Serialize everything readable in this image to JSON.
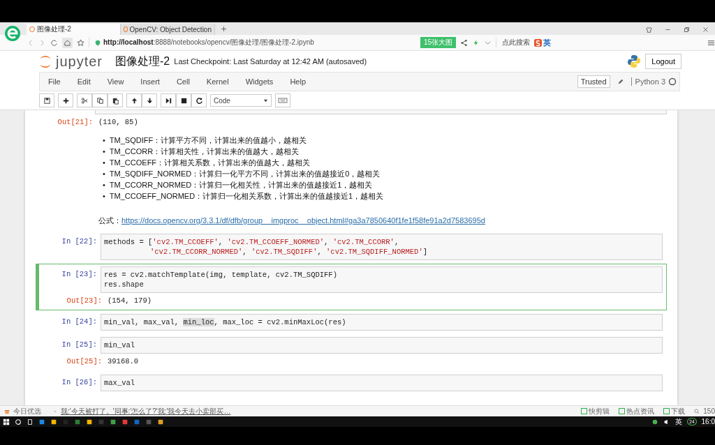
{
  "browser": {
    "tabs": [
      {
        "label": "图像处理-2",
        "selected": true
      },
      {
        "label": "OpenCV: Object Detection",
        "selected": false
      }
    ],
    "url_host": "http://localhost",
    "url_rest": ":8888/notebooks/opencv/图像处理/图像处理-2.ipynb",
    "badge": "15张大图",
    "search_hint": "点此搜索",
    "ime": "英"
  },
  "jupyter": {
    "logo": "jupyter",
    "title": "图像处理-2",
    "checkpoint": "Last Checkpoint: Last Saturday at 12:42 AM (autosaved)",
    "logout": "Logout",
    "menu": [
      "File",
      "Edit",
      "View",
      "Insert",
      "Cell",
      "Kernel",
      "Widgets",
      "Help"
    ],
    "trusted": "Trusted",
    "kernel": "Python 3",
    "cell_type": "Code"
  },
  "cells": [
    {
      "kind": "output",
      "prompt": "Out[21]:",
      "text": "(110, 85)"
    },
    {
      "kind": "markdown",
      "bullet": "•",
      "items": [
        "TM_SQDIFF：计算平方不同，计算出来的值越小，越相关",
        "TM_CCORR：计算相关性，计算出来的值越大，越相关",
        "TM_CCOEFF：计算相关系数，计算出来的值越大，越相关",
        "TM_SQDIFF_NORMED：计算归一化平方不同，计算出来的值越接近0，越相关",
        "TM_CCORR_NORMED：计算归一化相关性，计算出来的值越接近1，越相关",
        "TM_CCOEFF_NORMED：计算归一化相关系数，计算出来的值越接近1，越相关"
      ],
      "label": "公式：",
      "link": "https://docs.opencv.org/3.3.1/df/dfb/group__imgproc__object.html#ga3a7850640f1fe1f58fe91a2d7583695d"
    },
    {
      "kind": "code",
      "prompt": "In [22]:",
      "selected": false,
      "lines": [
        {
          "indent": false,
          "tokens": [
            {
              "t": "methods = [",
              "kind": "plain"
            },
            {
              "t": "'cv2.TM_CCOEFF'",
              "kind": "string"
            },
            {
              "t": ", ",
              "kind": "plain"
            },
            {
              "t": "'cv2.TM_CCOEFF_NORMED'",
              "kind": "string"
            },
            {
              "t": ", ",
              "kind": "plain"
            },
            {
              "t": "'cv2.TM_CCORR'",
              "kind": "string"
            },
            {
              "t": ",",
              "kind": "plain"
            }
          ]
        },
        {
          "indent": true,
          "tokens": [
            {
              "t": "'cv2.TM_CCORR_NORMED'",
              "kind": "string"
            },
            {
              "t": ", ",
              "kind": "plain"
            },
            {
              "t": "'cv2.TM_SQDIFF'",
              "kind": "string"
            },
            {
              "t": ", ",
              "kind": "plain"
            },
            {
              "t": "'cv2.TM_SQDIFF_NORMED'",
              "kind": "string"
            },
            {
              "t": "]",
              "kind": "plain"
            }
          ]
        }
      ]
    },
    {
      "kind": "code",
      "prompt": "In [23]:",
      "selected": true,
      "lines": [
        {
          "indent": false,
          "tokens": [
            {
              "t": "res = cv2.matchTemplate(img, template, cv2.TM_SQDIFF)",
              "kind": "plain"
            }
          ]
        },
        {
          "indent": false,
          "tokens": [
            {
              "t": "res.shape",
              "kind": "plain"
            }
          ]
        }
      ],
      "output": {
        "prompt": "Out[23]:",
        "text": "(154, 179)"
      }
    },
    {
      "kind": "code",
      "prompt": "In [24]:",
      "selected": false,
      "lines": [
        {
          "indent": false,
          "tokens": [
            {
              "t": "min_val, max_val, ",
              "kind": "plain"
            },
            {
              "t": "min_loc",
              "kind": "highlight"
            },
            {
              "t": ", max_loc = cv2.minMaxLoc(res)",
              "kind": "plain"
            }
          ]
        }
      ]
    },
    {
      "kind": "code",
      "prompt": "In [25]:",
      "selected": false,
      "lines": [
        {
          "indent": false,
          "tokens": [
            {
              "t": "min_val",
              "kind": "plain"
            }
          ]
        }
      ],
      "output": {
        "prompt": "Out[25]:",
        "text": "39168.0"
      }
    },
    {
      "kind": "code",
      "prompt": "In [26]:",
      "selected": false,
      "lines": [
        {
          "indent": false,
          "tokens": [
            {
              "t": "max_val",
              "kind": "plain"
            }
          ]
        }
      ]
    }
  ],
  "status_bar": {
    "left": "今日优选",
    "news": "我:'今天被打了。'同事:'怎么了?'我:'我今天去小卖部买…",
    "right": [
      "快剪辑",
      "热点资讯",
      "下载"
    ],
    "zoom": "150"
  },
  "taskbar": {
    "ime": "英",
    "badge": "24",
    "clock": "16:0"
  }
}
